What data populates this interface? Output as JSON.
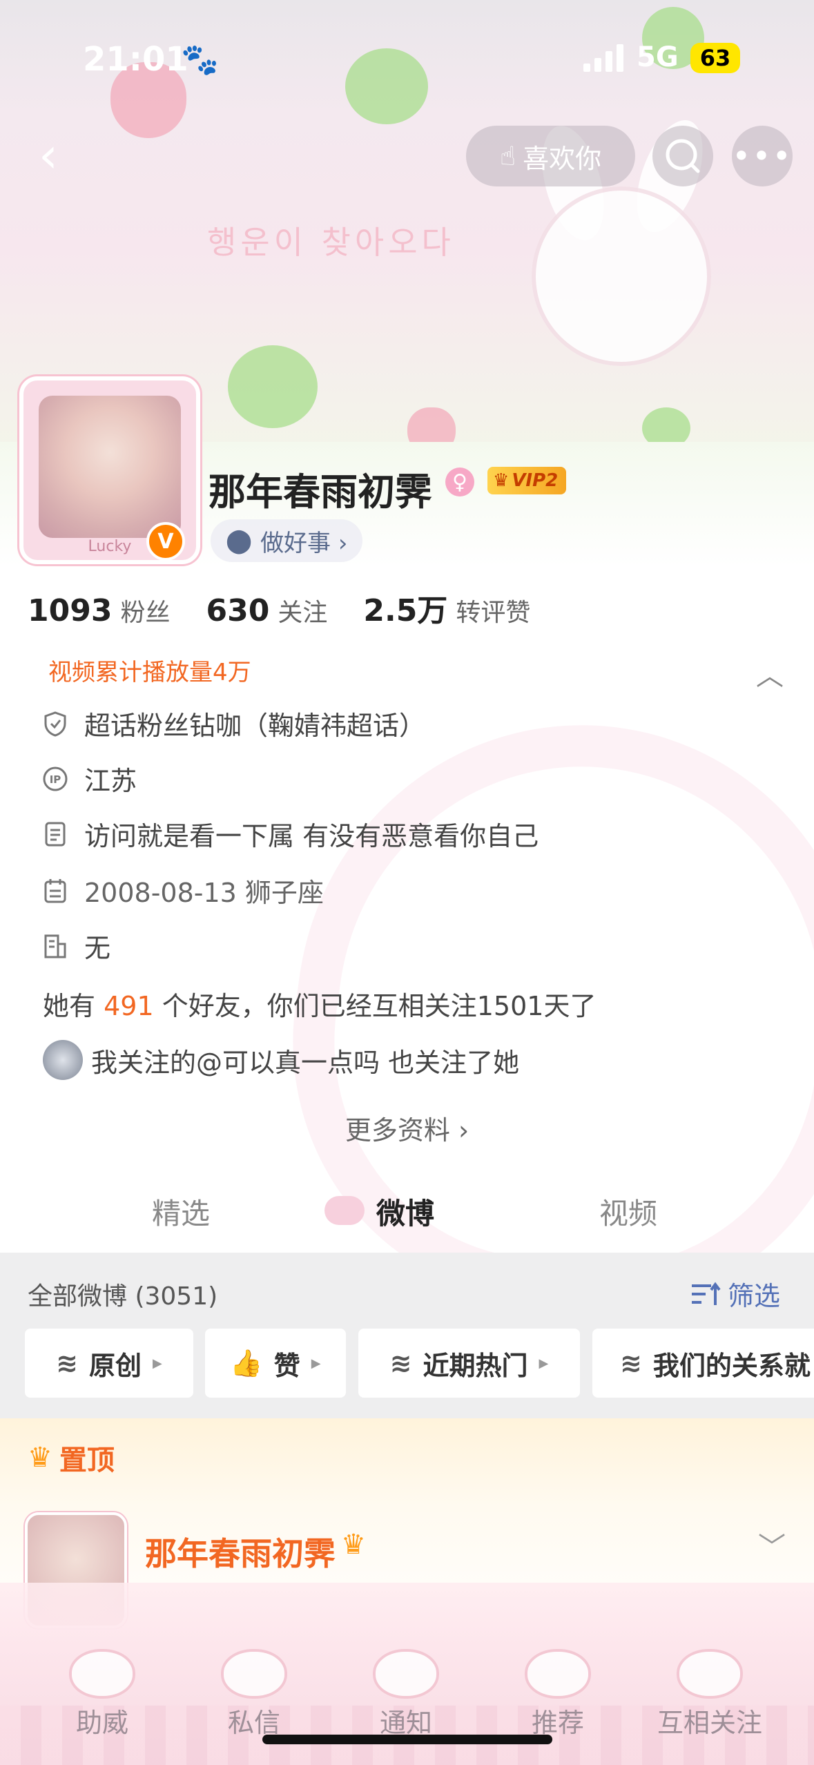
{
  "status_bar": {
    "time": "21:01",
    "network": "5G",
    "battery": "63"
  },
  "nav": {
    "like_label": "喜欢你"
  },
  "hero": {
    "banner_text": "행운이 찾아오다"
  },
  "profile": {
    "avatar_label": "Lucky",
    "verified_badge": "V",
    "username": "那年春雨初霁",
    "gender_symbol": "♀",
    "vip_label": "VIP2",
    "good_deed_label": "做好事 ›",
    "stats": [
      {
        "number": "1093",
        "label": "粉丝"
      },
      {
        "number": "630",
        "label": "关注"
      },
      {
        "number": "2.5万",
        "label": "转评赞"
      }
    ],
    "video_plays": "视频累计播放量4万",
    "info": [
      {
        "icon": "shield-icon",
        "text": "超话粉丝钻咖（鞠婧祎超话）"
      },
      {
        "icon": "ip-icon",
        "text": "江苏"
      },
      {
        "icon": "document-icon",
        "text": "访问就是看一下属 有没有恶意看你自己"
      },
      {
        "icon": "calendar-icon",
        "text": "2008-08-13 狮子座"
      },
      {
        "icon": "building-icon",
        "text": "无"
      }
    ],
    "friends_prefix": "她有",
    "friends_count": "491",
    "friends_suffix": "个好友，你们已经互相关注1501天了",
    "mutual_text": "我关注的@可以真一点吗 也关注了她",
    "more_info": "更多资料 ›"
  },
  "tabs": {
    "items": [
      "精选",
      "微博",
      "视频"
    ],
    "active": "微博"
  },
  "filter": {
    "all_weibo": "全部微博 (3051)",
    "filter_label": "筛选",
    "chips": [
      "原创",
      "赞",
      "近期热门",
      "我们的关系就"
    ]
  },
  "pinned": {
    "label": "置顶",
    "author": "那年春雨初霁"
  },
  "bottom_bar": {
    "items": [
      "助威",
      "私信",
      "通知",
      "推荐",
      "互相关注"
    ]
  },
  "colors": {
    "accent_orange": "#f26722",
    "link_blue": "#5471b7",
    "verified_orange": "#ff8200"
  }
}
